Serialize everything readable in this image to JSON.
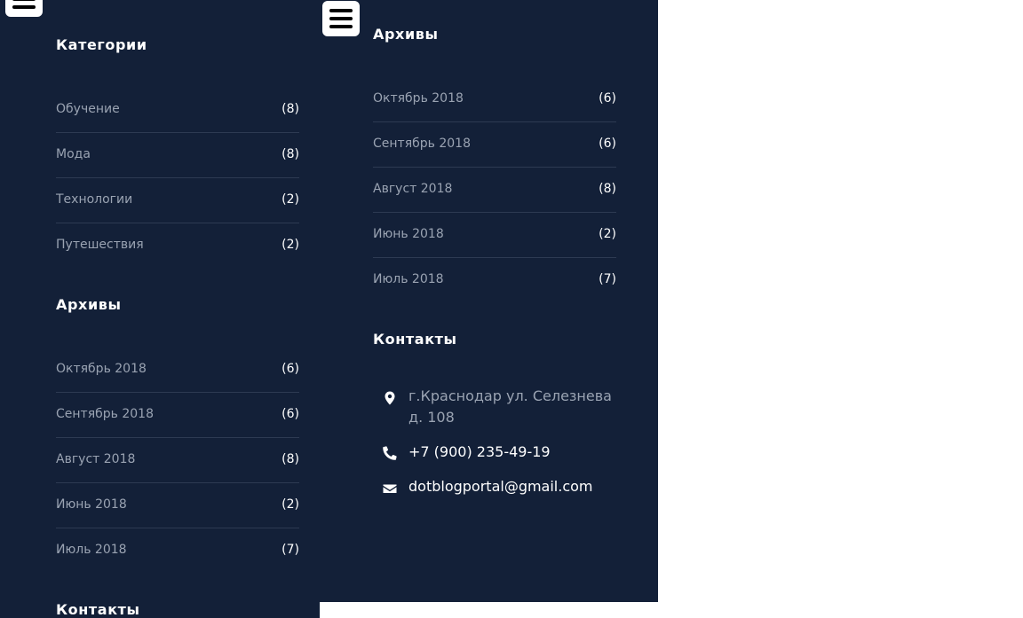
{
  "left_panel": {
    "categories": {
      "title": "Категории",
      "items": [
        {
          "label": "Обучение",
          "count": "(8)"
        },
        {
          "label": "Мода",
          "count": "(8)"
        },
        {
          "label": "Технологии",
          "count": "(2)"
        },
        {
          "label": "Путешествия",
          "count": "(2)"
        }
      ]
    },
    "archives": {
      "title": "Архивы",
      "items": [
        {
          "label": "Октябрь 2018",
          "count": "(6)"
        },
        {
          "label": "Сентябрь 2018",
          "count": "(6)"
        },
        {
          "label": "Август 2018",
          "count": "(8)"
        },
        {
          "label": "Июнь 2018",
          "count": "(2)"
        },
        {
          "label": "Июль 2018",
          "count": "(7)"
        }
      ]
    },
    "contacts": {
      "title": "Контакты"
    }
  },
  "right_panel": {
    "archives": {
      "title": "Архивы",
      "items": [
        {
          "label": "Октябрь 2018",
          "count": "(6)"
        },
        {
          "label": "Сентябрь 2018",
          "count": "(6)"
        },
        {
          "label": "Август 2018",
          "count": "(8)"
        },
        {
          "label": "Июнь 2018",
          "count": "(2)"
        },
        {
          "label": "Июль 2018",
          "count": "(7)"
        }
      ]
    },
    "contacts": {
      "title": "Контакты",
      "address_line1": "г.Краснодар ул. Селезнева",
      "address_line2": "д. 108",
      "phone": "+7 (900) 235-49-19",
      "email": "dotblogportal@gmail.com"
    }
  },
  "icons": {
    "menu": "hamburger-menu-icon",
    "address": "map-marker-icon",
    "phone": "phone-icon",
    "email": "envelope-icon"
  },
  "colors": {
    "panel_background": "#132038",
    "heading_text": "#ffffff",
    "link_text": "#9aa3b2",
    "divider": "#2d3a52",
    "page_background": "#ffffff"
  }
}
